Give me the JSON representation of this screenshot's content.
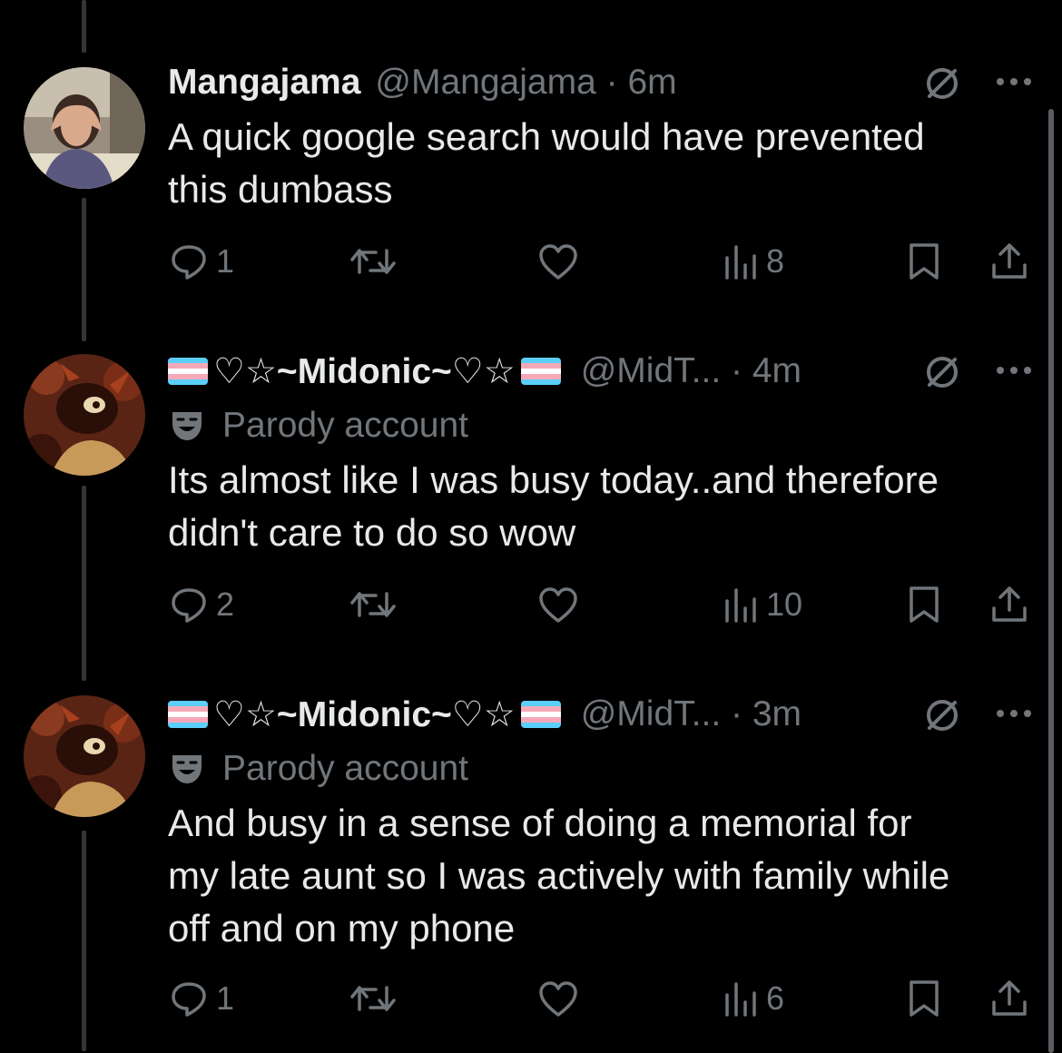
{
  "tweets": [
    {
      "name": "Mangajama",
      "handle": "@Mangajama",
      "time": "6m",
      "parody": "",
      "lines": [
        "A quick google search would have prevented",
        "this dumbass"
      ],
      "replies": "1",
      "reposts": "",
      "likes": "",
      "views": "8"
    },
    {
      "name": "♡☆~Midonic~♡☆",
      "handle": "@MidT...",
      "time": "4m",
      "parody": "Parody account",
      "lines": [
        "Its almost like I was busy today..and therefore",
        "didn't care to do so wow"
      ],
      "replies": "2",
      "reposts": "",
      "likes": "",
      "views": "10"
    },
    {
      "name": "♡☆~Midonic~♡☆",
      "handle": "@MidT...",
      "time": "3m",
      "parody": "Parody account",
      "lines": [
        "And busy in a sense of doing a memorial for",
        "my late aunt so I was actively with family while",
        "off and on my phone"
      ],
      "replies": "1",
      "reposts": "",
      "likes": "",
      "views": "6"
    }
  ],
  "icons": {
    "reply": "reply-icon",
    "repost": "repost-icon",
    "like": "heart-icon",
    "views": "views-icon",
    "bookmark": "bookmark-icon",
    "share": "share-icon",
    "grok": "grok-icon",
    "more": "more-icon",
    "parody": "parody-mask-icon",
    "flag": "trans-flag-icon"
  },
  "colors": {
    "background": "#000000",
    "text": "#e7e9ea",
    "secondary": "#71767b",
    "divider": "#333639",
    "flag_blue": "#5bcefa",
    "flag_pink": "#f5a9b8",
    "flag_white": "#ffffff"
  }
}
